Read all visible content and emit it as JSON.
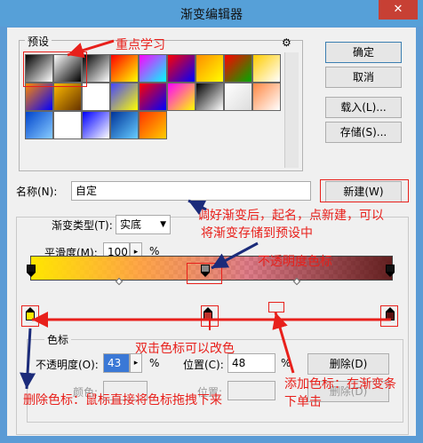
{
  "window": {
    "title": "渐变编辑器",
    "close_icon": "✕"
  },
  "presets": {
    "legend": "预设",
    "gear_icon": "⚙",
    "swatch_colors": [
      [
        "#000000",
        "#ffffff"
      ],
      [
        "#ffffff",
        "#000000"
      ],
      [
        "#000000",
        "#ffffff"
      ],
      [
        "#ff0000",
        "#ffff00"
      ],
      [
        "#ff00ff",
        "#00ffff"
      ],
      [
        "#ff0000",
        "#0000ff"
      ],
      [
        "#ff8c00",
        "#ffff00"
      ],
      [
        "#ff0000",
        "#00aa00"
      ],
      [
        "#ffcc00",
        "#ffffff"
      ],
      [
        "#ff8800",
        "#0000ff"
      ],
      [
        "#ffbb00",
        "#663300"
      ],
      [
        "#ffffff",
        "#ffffff"
      ],
      [
        "#4444ff",
        "#ffff00"
      ],
      [
        "#ff0000",
        "#0000ff"
      ],
      [
        "#ff00ff",
        "#ffff00"
      ],
      [
        "#000000",
        "#ffffff"
      ],
      [
        "#ffffff",
        "#dddddd"
      ],
      [
        "#ff8844",
        "#ffffff"
      ],
      [
        "#0044cc",
        "#88ccff"
      ],
      [
        "#ffffff",
        "#ffffff"
      ],
      [
        "#0000ff",
        "#ffffff"
      ],
      [
        "#003399",
        "#66ccff"
      ],
      [
        "#ff3300",
        "#ffcc00"
      ]
    ]
  },
  "buttons": {
    "ok": "确定",
    "cancel": "取消",
    "load": "载入(L)...",
    "save": "存储(S)...",
    "new": "新建(W)",
    "delete_stop": "删除(D)",
    "delete_stop_disabled": "删除(D)"
  },
  "name": {
    "label": "名称(N):",
    "value": "自定"
  },
  "gradient": {
    "type_label": "渐变类型(T):",
    "type_value": "实底",
    "smooth_label": "平滑度(M):",
    "smooth_value": "100",
    "percent": "%"
  },
  "stops": {
    "legend": "色标",
    "opacity_label": "不透明度(O):",
    "opacity_value": "43",
    "location_label": "位置(C):",
    "location_value": "48",
    "color_label": "颜色:",
    "color_location_label": "位置:",
    "percent": "%"
  },
  "annotations": {
    "learn": "重点学习",
    "save_preset_line1": "调好渐变后，起名，点新建，可以",
    "save_preset_line2": "将渐变存储到预设中",
    "opacity_stop": "不透明度色标",
    "double_click": "双击色标可以改色",
    "add_stop_line1": "添加色标：在渐变条",
    "add_stop_line2": "下单击",
    "delete_stop": "删除色标：鼠标直接将色标拖拽下来"
  }
}
